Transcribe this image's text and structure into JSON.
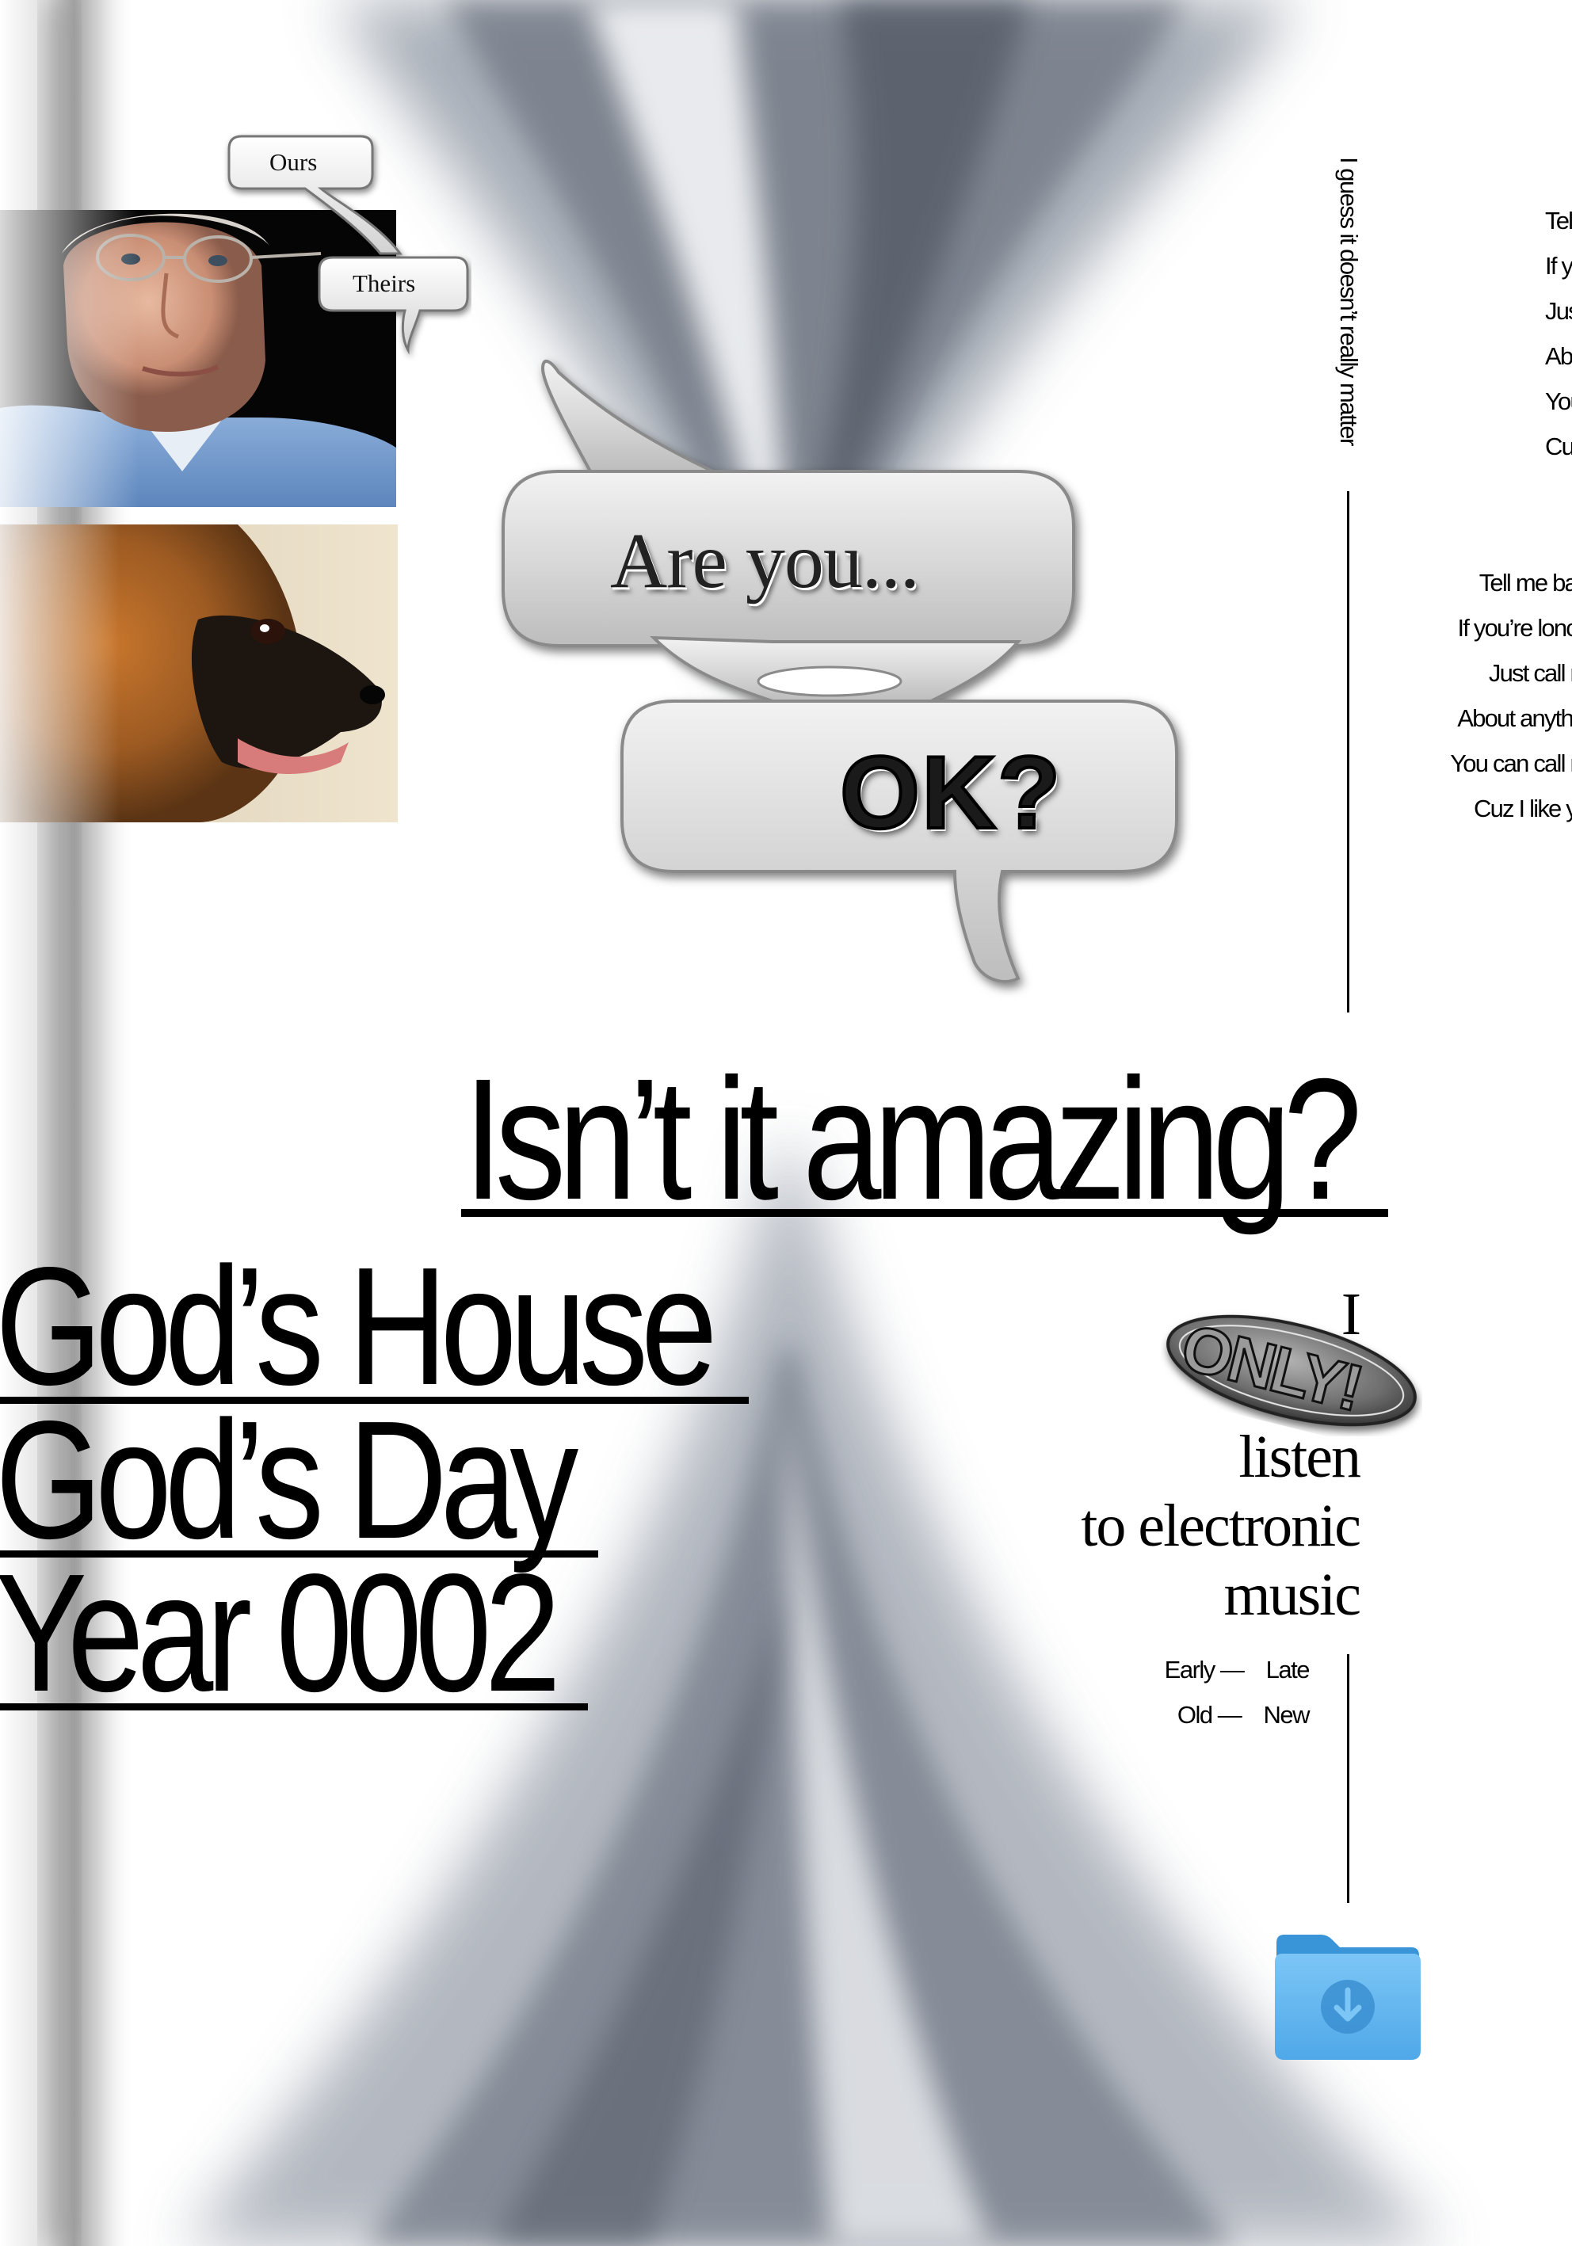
{
  "bubbles": {
    "ours": "Ours",
    "theirs": "Theirs",
    "are_you": "Are you...",
    "ok": "OK?"
  },
  "headline": "Isn’t it amazing?",
  "title_lines": [
    "God’s House",
    "God’s Day",
    "Year 0002"
  ],
  "vertical_text": "I guess it doesn’t really matter",
  "lyrics_top": [
    "Tel",
    "If y",
    "Jus",
    "Abo",
    "You",
    "Cu"
  ],
  "lyrics_mid": [
    "Tell me ba",
    "If you’re lonc",
    "Just call r",
    "About anythi",
    "You can call r",
    "Cuz I like y"
  ],
  "only_block": {
    "i": "I",
    "only": "ONLY!",
    "line1": "listen",
    "line2": "to electronic",
    "line3": "music"
  },
  "pairs": [
    {
      "left": "Early —",
      "right": "Late"
    },
    {
      "left": "Old —",
      "right": "New"
    }
  ],
  "icons": [
    "download-folder-icon"
  ],
  "colors": {
    "folder": "#5fb4ee",
    "folder_dark": "#3a95d8",
    "vortex": "#7c8491"
  }
}
